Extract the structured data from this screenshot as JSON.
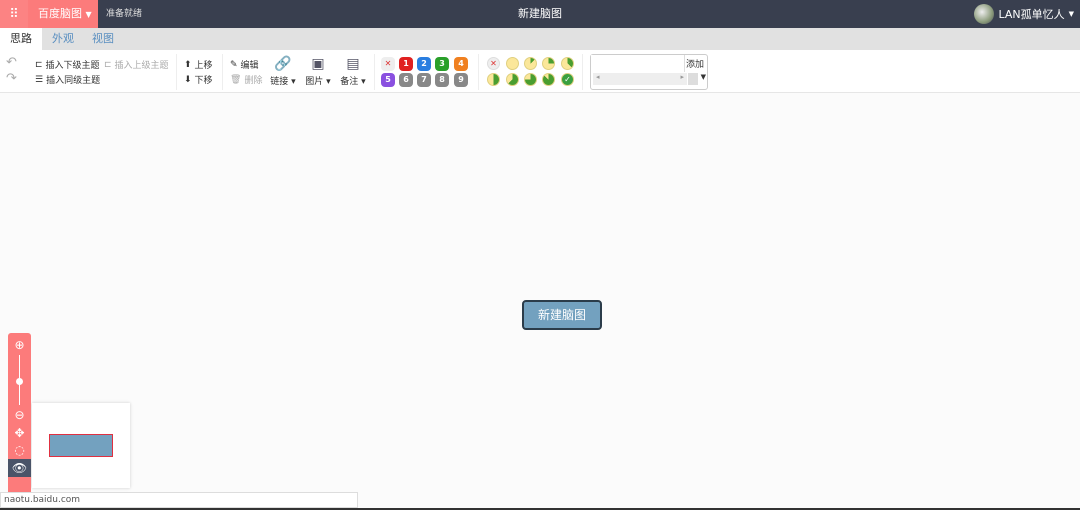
{
  "header": {
    "brand": "百度脑图",
    "status": "准备就绪",
    "title": "新建脑图",
    "user": "LAN孤单忆人"
  },
  "tabs": [
    {
      "label": "思路"
    },
    {
      "label": "外观"
    },
    {
      "label": "视图"
    }
  ],
  "toolbar": {
    "insert_child": "插入下级主题",
    "insert_parent": "插入上级主题",
    "insert_sibling": "插入同级主题",
    "move_up": "上移",
    "move_down": "下移",
    "edit": "编辑",
    "delete": "删除",
    "link": "链接",
    "image": "图片",
    "note": "备注",
    "add": "添加"
  },
  "priorities": [
    "1",
    "2",
    "3",
    "4",
    "5",
    "6",
    "7",
    "8",
    "9"
  ],
  "priority_colors": [
    "#e02020",
    "#2a7ee0",
    "#2aa02a",
    "#f08020",
    "#8a50e0",
    "#888888",
    "#888888",
    "#888888",
    "#888888"
  ],
  "progress_levels": [
    0,
    0.125,
    0.25,
    0.375,
    0.5,
    0.625,
    0.75,
    0.875,
    1
  ],
  "canvas": {
    "root_node": "新建脑图"
  },
  "node_color": "#73a1bf",
  "statusbar": {
    "url": "naotu.baidu.com"
  }
}
